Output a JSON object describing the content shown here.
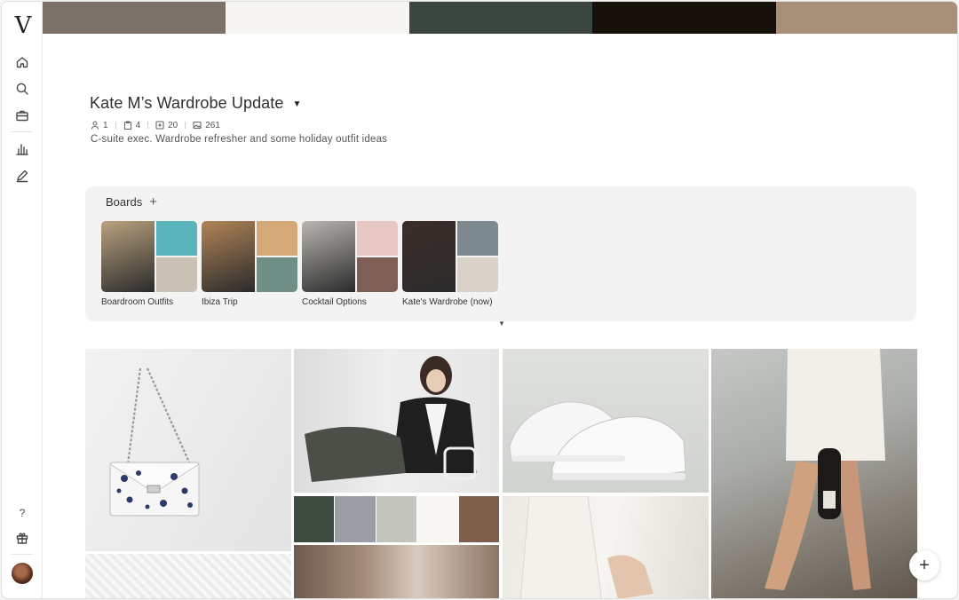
{
  "app": {
    "logo_text": "V"
  },
  "sidebar": {
    "items": [
      {
        "name": "home",
        "icon": "home-icon"
      },
      {
        "name": "search",
        "icon": "search-icon"
      },
      {
        "name": "projects",
        "icon": "briefcase-icon"
      },
      {
        "name": "analytics",
        "icon": "bar-chart-icon"
      },
      {
        "name": "edit",
        "icon": "pen-icon"
      }
    ],
    "help_label": "?",
    "gift_icon": "gift-icon"
  },
  "palette": [
    "#7b7169",
    "#f6f5f1",
    "#3b463f",
    "#17110c",
    "#a88f78"
  ],
  "project": {
    "title": "Kate M’s Wardrobe Update",
    "stats": {
      "members": "1",
      "boards": "4",
      "items": "20",
      "images": "261"
    },
    "description": "C-suite exec. Wardrobe refresher and some holiday outfit ideas"
  },
  "boards": {
    "title": "Boards",
    "add_label": "+",
    "items": [
      {
        "label": "Boardroom Outfits",
        "colors": [
          "#b9a27e",
          "#5bb3bb",
          "#c9c2b4"
        ]
      },
      {
        "label": "Ibiza Trip",
        "colors": [
          "#b08456",
          "#d4a877",
          "#6f8e86"
        ]
      },
      {
        "label": "Cocktail Options",
        "colors": [
          "#b9b6b1",
          "#e8c7c4",
          "#7f5f55"
        ]
      },
      {
        "label": "Kate's Wardrobe (now)",
        "colors": [
          "#3c2d2a",
          "#7c8a90",
          "#d9d2c9"
        ]
      }
    ]
  },
  "mini_palette": [
    "#3d4a40",
    "#9b9ea4",
    "#c3c4bc",
    "#f7f6f2",
    "#7e5e4a"
  ],
  "fab_label": "+"
}
